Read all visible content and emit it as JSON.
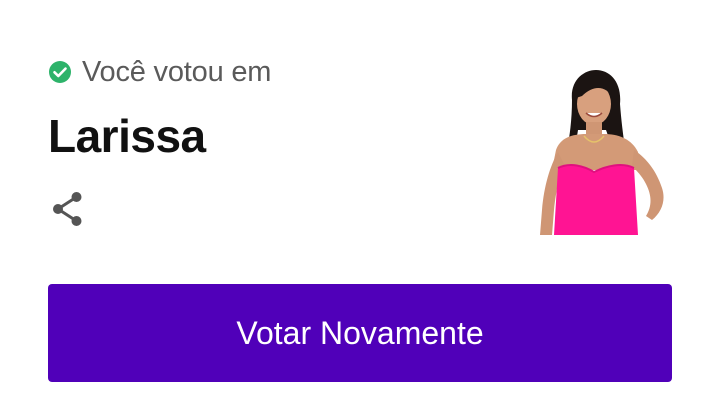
{
  "vote_confirmation": {
    "voted_label": "Você votou em",
    "candidate_name": "Larissa",
    "check_icon": "check-circle-icon",
    "share_icon": "share-icon"
  },
  "actions": {
    "vote_again_label": "Votar Novamente"
  },
  "colors": {
    "check_green": "#2db36a",
    "button_purple": "#5000b9",
    "name_color": "#111111",
    "label_color": "#5a5a5a",
    "outfit_pink": "#ff1493"
  }
}
